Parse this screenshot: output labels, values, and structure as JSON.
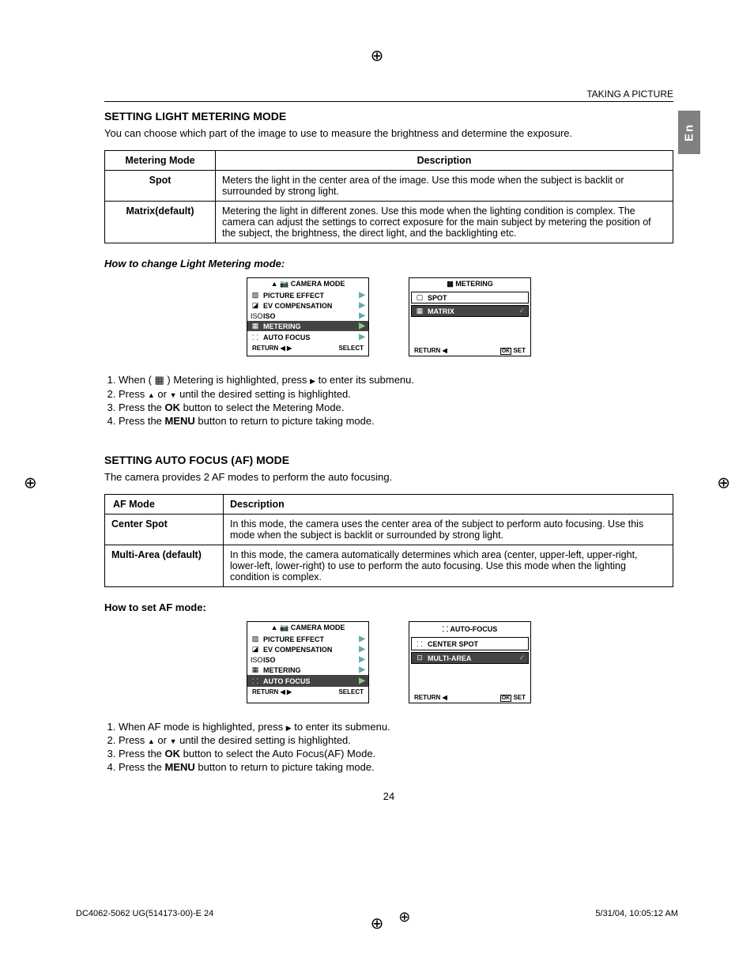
{
  "running_head": "TAKING A PICTURE",
  "lang_tab": "En",
  "section1": {
    "title": "SETTING LIGHT METERING MODE",
    "intro": "You can choose which part of the image to use to measure the brightness and determine the exposure.",
    "th1": "Metering Mode",
    "th2": "Description",
    "rows": [
      {
        "name": "Spot",
        "desc": "Meters the light in the center area of the image. Use this mode when the subject is backlit or surrounded by strong light."
      },
      {
        "name": "Matrix(default)",
        "desc": "Metering the light in different zones. Use this mode when the lighting condition is complex. The camera can adjust the settings to correct exposure for the main subject by metering the position of the subject, the brightness, the direct light, and the backlighting etc."
      }
    ],
    "howto": "How to change Light Metering mode:",
    "menuA": {
      "title": "CAMERA MODE",
      "items": [
        "PICTURE EFFECT",
        "EV COMPENSATION",
        "ISO",
        "METERING",
        "AUTO FOCUS"
      ],
      "highlight": 3,
      "footer_left": "RETURN",
      "footer_right": "SELECT"
    },
    "menuB": {
      "title": "METERING",
      "opts": [
        "SPOT",
        "MATRIX"
      ],
      "highlight": 1,
      "footer_left": "RETURN",
      "footer_right": "SET",
      "ok": "OK"
    },
    "steps": [
      "When ( ▦ ) Metering is highlighted, press ▶ to enter its submenu.",
      "Press ▲ or ▼ until the desired setting is highlighted.",
      "Press the OK button to select the Metering Mode.",
      "Press the MENU button to return to picture taking mode."
    ]
  },
  "section2": {
    "title": "SETTING AUTO FOCUS (AF) MODE",
    "intro": "The camera provides 2 AF modes to perform the auto focusing.",
    "th1": "AF Mode",
    "th2": "Description",
    "rows": [
      {
        "name": "Center Spot",
        "desc": "In this mode, the camera uses the center area of the subject to perform auto focusing. Use this mode when the subject is backlit or surrounded by strong light."
      },
      {
        "name": "Multi-Area (default)",
        "desc": "In this mode, the camera automatically determines which area (center, upper-left, upper-right, lower-left, lower-right) to use to perform the auto focusing. Use this mode when the lighting condition is complex."
      }
    ],
    "howto": "How to set AF mode:",
    "menuA": {
      "title": "CAMERA MODE",
      "items": [
        "PICTURE EFFECT",
        "EV COMPENSATION",
        "ISO",
        "METERING",
        "AUTO FOCUS"
      ],
      "highlight": 4,
      "footer_left": "RETURN",
      "footer_right": "SELECT"
    },
    "menuB": {
      "title": "AUTO-FOCUS",
      "opts": [
        "CENTER SPOT",
        "MULTI-AREA"
      ],
      "highlight": 1,
      "footer_left": "RETURN",
      "footer_right": "SET",
      "ok": "OK"
    },
    "steps": [
      "When AF mode is highlighted, press ▶ to enter its submenu.",
      "Press ▲ or ▼ until the desired setting is highlighted.",
      "Press the OK button to select the Auto Focus(AF) Mode.",
      "Press the MENU button to return to picture taking mode."
    ]
  },
  "pagenum": "24",
  "footer": {
    "left": "DC4062-5062 UG(514173-00)-E   24",
    "right": "5/31/04, 10:05:12 AM"
  },
  "bold_words": {
    "ok": "OK",
    "menu": "MENU"
  }
}
